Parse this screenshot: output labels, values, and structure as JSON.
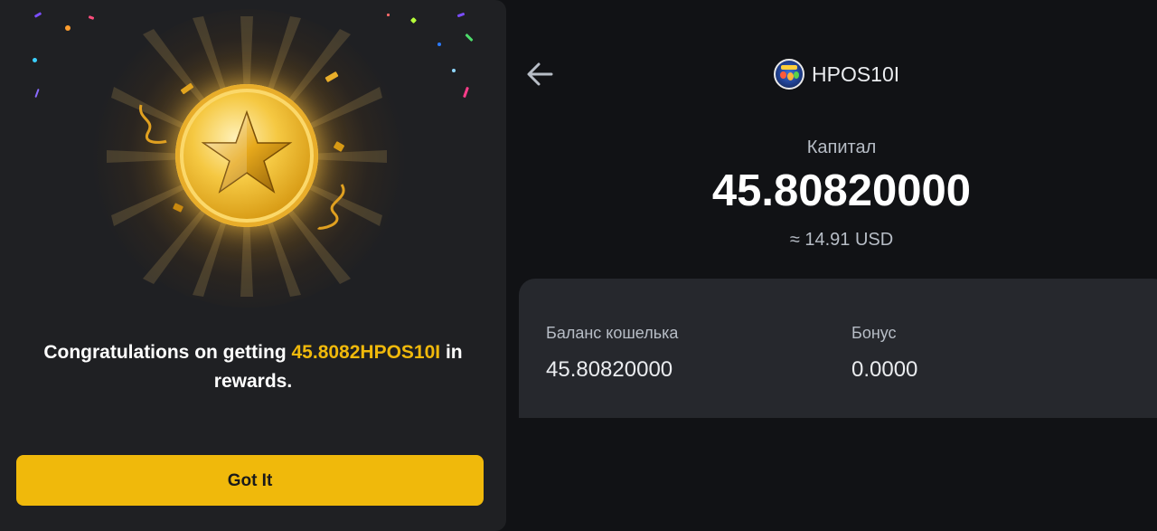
{
  "reward_modal": {
    "message_prefix": "Congratulations on getting ",
    "reward_amount": "45.8082HPOS10I",
    "message_suffix": " in rewards.",
    "button_label": "Got It",
    "highlight_color": "#f0b90b",
    "button_color": "#f0b90b",
    "icon": "star-coin-icon"
  },
  "header": {
    "back_icon": "arrow-left-icon",
    "token_name": "HPOS10I",
    "token_icon": "token-avatar-icon"
  },
  "capital": {
    "label": "Капитал",
    "value": "45.80820000",
    "usd_equivalent": "≈ 14.91 USD"
  },
  "balances": {
    "wallet_label": "Баланс кошелька",
    "wallet_value": "45.80820000",
    "bonus_label": "Бонус",
    "bonus_value": "0.0000"
  }
}
